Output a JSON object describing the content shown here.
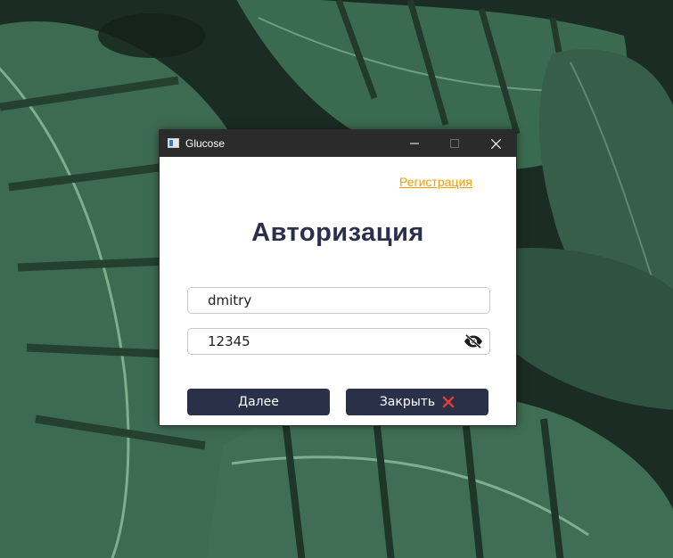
{
  "window": {
    "title": "Glucose",
    "icon": "app-icon",
    "controls": [
      "minimize-icon",
      "maximize-icon",
      "close-icon"
    ]
  },
  "auth": {
    "register_link": "Регистрация",
    "heading": "Авторизация",
    "login_value": "dmitry",
    "password_value": "12345",
    "password_toggle_icon": "eye-slash-icon",
    "next_label": "Далее",
    "close_label": "Закрыть",
    "close_icon": "red-x-icon"
  },
  "colors": {
    "link": "#f29f05",
    "heading": "#2a2f4d",
    "button_bg": "#2a3048",
    "titlebar_bg": "#2b2b2b",
    "close_icon": "#e03c31"
  }
}
